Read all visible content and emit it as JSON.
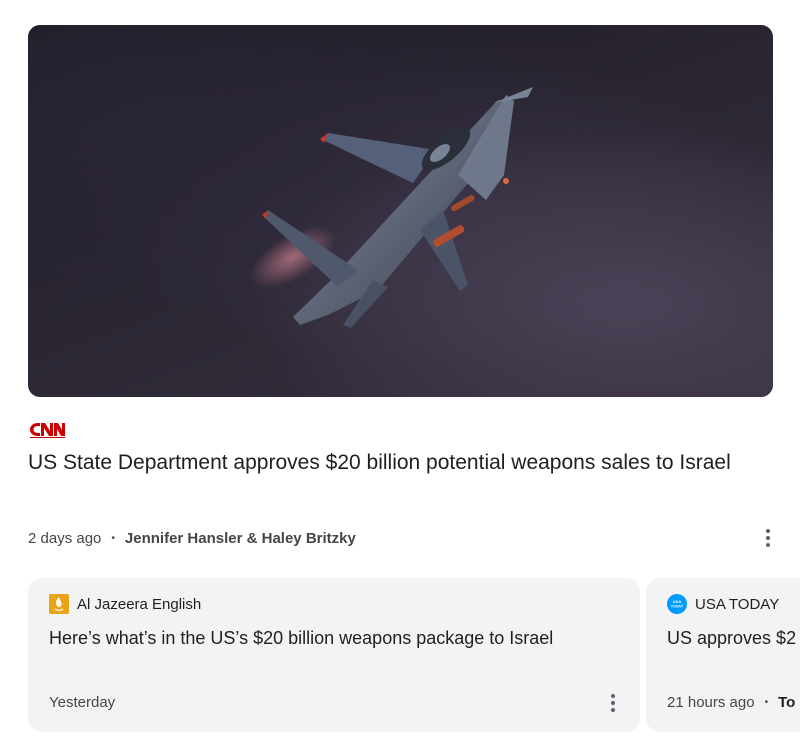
{
  "hero": {
    "image_alt": "Fighter jet in flight against a dark sky"
  },
  "main_story": {
    "source": "CNN",
    "headline": "US State Department approves $20 billion potential weapons sales to Israel",
    "time": "2 days ago",
    "authors": "Jennifer Hansler & Haley Britzky",
    "separator": "•"
  },
  "cards": [
    {
      "source": "Al Jazeera English",
      "title": "Here’s what’s in the US’s $20 billion weapons package to Israel",
      "time": "Yesterday"
    },
    {
      "source": "USA TODAY",
      "title": "US approves $2",
      "time": "21 hours ago",
      "separator": "•",
      "author_fragment": "To"
    }
  ],
  "colors": {
    "cnn_red": "#cc0000",
    "aljazeera_gold": "#e8a317",
    "usatoday_blue": "#009bff",
    "card_bg": "#f2f3f5"
  },
  "icons": [
    "more-vert-icon",
    "cnn-logo",
    "aljazeera-logo",
    "usatoday-logo"
  ]
}
